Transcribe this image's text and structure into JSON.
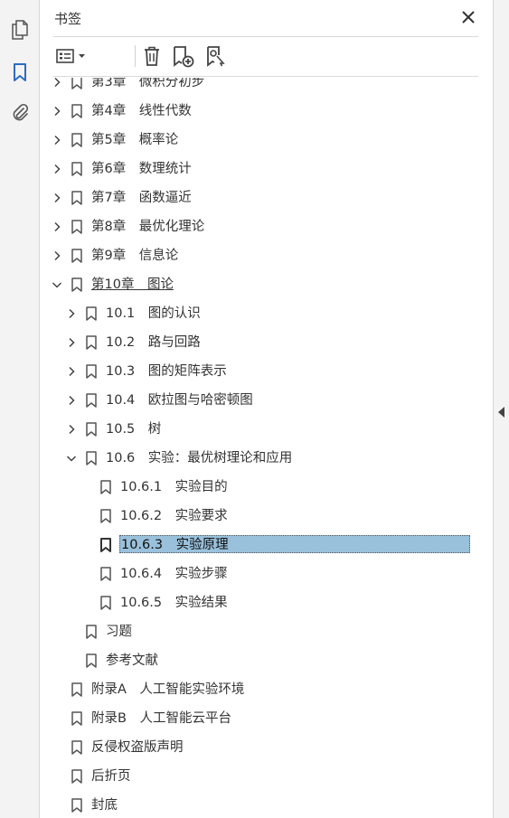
{
  "panel": {
    "title": "书签"
  },
  "scroll": {
    "position": 0.49,
    "visible_fraction": 0.51
  },
  "colors": {
    "selection": "#99c1dc",
    "rail_active_icon": "#2d6cc0"
  },
  "rail": [
    {
      "name": "pages-icon",
      "active": false
    },
    {
      "name": "bookmark-icon",
      "active": true
    },
    {
      "name": "attachment-icon",
      "active": false
    }
  ],
  "tree": [
    {
      "label": "第3章　微积分初步",
      "level": 0,
      "state": "collapsed"
    },
    {
      "label": "第4章　线性代数",
      "level": 0,
      "state": "collapsed"
    },
    {
      "label": "第5章　概率论",
      "level": 0,
      "state": "collapsed"
    },
    {
      "label": "第6章　数理统计",
      "level": 0,
      "state": "collapsed"
    },
    {
      "label": "第7章　函数逼近",
      "level": 0,
      "state": "collapsed"
    },
    {
      "label": "第8章　最优化理论",
      "level": 0,
      "state": "collapsed"
    },
    {
      "label": "第9章　信息论",
      "level": 0,
      "state": "collapsed"
    },
    {
      "label": "第10章　图论",
      "level": 0,
      "state": "expanded",
      "current": true
    },
    {
      "label": "10.1　图的认识",
      "level": 1,
      "state": "collapsed"
    },
    {
      "label": "10.2　路与回路",
      "level": 1,
      "state": "collapsed"
    },
    {
      "label": "10.3　图的矩阵表示",
      "level": 1,
      "state": "collapsed"
    },
    {
      "label": "10.4　欧拉图与哈密顿图",
      "level": 1,
      "state": "collapsed"
    },
    {
      "label": "10.5　树",
      "level": 1,
      "state": "collapsed"
    },
    {
      "label": "10.6　实验：最优树理论和应用",
      "level": 1,
      "state": "expanded"
    },
    {
      "label": "10.6.1　实验目的",
      "level": 2,
      "state": "leaf"
    },
    {
      "label": "10.6.2　实验要求",
      "level": 2,
      "state": "leaf"
    },
    {
      "label": "10.6.3　实验原理",
      "level": 2,
      "state": "leaf",
      "selected": true
    },
    {
      "label": "10.6.4　实验步骤",
      "level": 2,
      "state": "leaf"
    },
    {
      "label": "10.6.5　实验结果",
      "level": 2,
      "state": "leaf"
    },
    {
      "label": "习题",
      "level": 1,
      "state": "leaf"
    },
    {
      "label": "参考文献",
      "level": 1,
      "state": "leaf"
    },
    {
      "label": "附录A　人工智能实验环境",
      "level": 0,
      "state": "leaf"
    },
    {
      "label": "附录B　人工智能云平台",
      "level": 0,
      "state": "leaf"
    },
    {
      "label": "反侵权盗版声明",
      "level": 0,
      "state": "leaf"
    },
    {
      "label": "后折页",
      "level": 0,
      "state": "leaf"
    },
    {
      "label": "封底",
      "level": 0,
      "state": "leaf"
    }
  ]
}
